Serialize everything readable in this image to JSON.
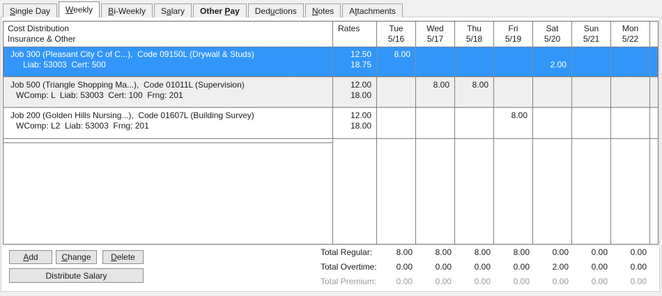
{
  "tabs": [
    {
      "pre": "",
      "u": "S",
      "post": "ingle Day"
    },
    {
      "pre": "",
      "u": "W",
      "post": "eekly"
    },
    {
      "pre": "",
      "u": "B",
      "post": "i-Weekly"
    },
    {
      "pre": "S",
      "u": "a",
      "post": "lary"
    },
    {
      "pre": "Other ",
      "u": "P",
      "post": "ay"
    },
    {
      "pre": "Ded",
      "u": "u",
      "post": "ctions"
    },
    {
      "pre": "",
      "u": "N",
      "post": "otes"
    },
    {
      "pre": "A",
      "u": "t",
      "post": "tachments"
    }
  ],
  "grid": {
    "header": {
      "title1": "Cost Distribution",
      "title2": "Insurance & Other",
      "rates": "Rates",
      "days": [
        {
          "d": "Tue",
          "dt": "5/16"
        },
        {
          "d": "Wed",
          "dt": "5/17"
        },
        {
          "d": "Thu",
          "dt": "5/18"
        },
        {
          "d": "Fri",
          "dt": "5/19"
        },
        {
          "d": "Sat",
          "dt": "5/20"
        },
        {
          "d": "Sun",
          "dt": "5/21"
        },
        {
          "d": "Mon",
          "dt": "5/22"
        }
      ]
    },
    "rows": [
      {
        "title": "Job 300 (Pleasant City C of C...),  Code 09150L (Drywall & Studs)",
        "detail": "Liab: 53003  Cert: 500",
        "rate1": "12.50",
        "rate2": "18.75",
        "l1": [
          "8.00",
          "",
          "",
          "",
          "",
          "",
          ""
        ],
        "l2": [
          "",
          "",
          "",
          "",
          "2.00",
          "",
          ""
        ],
        "selected": true
      },
      {
        "title": "Job 500 (Triangle Shopping Ma...),  Code 01011L (Supervision)",
        "detail": "WComp: L  Liab: 53003  Cert: 100  Frng: 201",
        "rate1": "12.00",
        "rate2": "18.00",
        "l1": [
          "",
          "8.00",
          "8.00",
          "",
          "",
          "",
          ""
        ],
        "l2": [
          "",
          "",
          "",
          "",
          "",
          "",
          ""
        ],
        "selected": false
      },
      {
        "title": "Job 200 (Golden Hills Nursing...),  Code 01607L (Building Survey)",
        "detail": "WComp: L2  Liab: 53003  Frng: 201",
        "rate1": "12.00",
        "rate2": "18.00",
        "l1": [
          "",
          "",
          "",
          "8.00",
          "",
          "",
          ""
        ],
        "l2": [
          "",
          "",
          "",
          "",
          "",
          "",
          ""
        ],
        "selected": false
      }
    ]
  },
  "buttons": {
    "add": {
      "u": "A",
      "post": "dd"
    },
    "change": {
      "u": "C",
      "post": "hange"
    },
    "delete": {
      "u": "D",
      "post": "elete"
    },
    "distribute": {
      "label": "Distribute Salary"
    }
  },
  "totals": {
    "regular": {
      "label": "Total Regular:",
      "values": [
        "8.00",
        "8.00",
        "8.00",
        "8.00",
        "0.00",
        "0.00",
        "0.00"
      ]
    },
    "overtime": {
      "label": "Total Overtime:",
      "values": [
        "0.00",
        "0.00",
        "0.00",
        "0.00",
        "2.00",
        "0.00",
        "0.00"
      ]
    },
    "premium": {
      "label": "Total Premium:",
      "values": [
        "0.00",
        "0.00",
        "0.00",
        "0.00",
        "0.00",
        "0.00",
        "0.00"
      ]
    }
  },
  "colors": {
    "selection_blue": "#3296fa",
    "grid_line": "#808080",
    "alt_row": "#efefef",
    "focus_dotted": "#c87840"
  }
}
